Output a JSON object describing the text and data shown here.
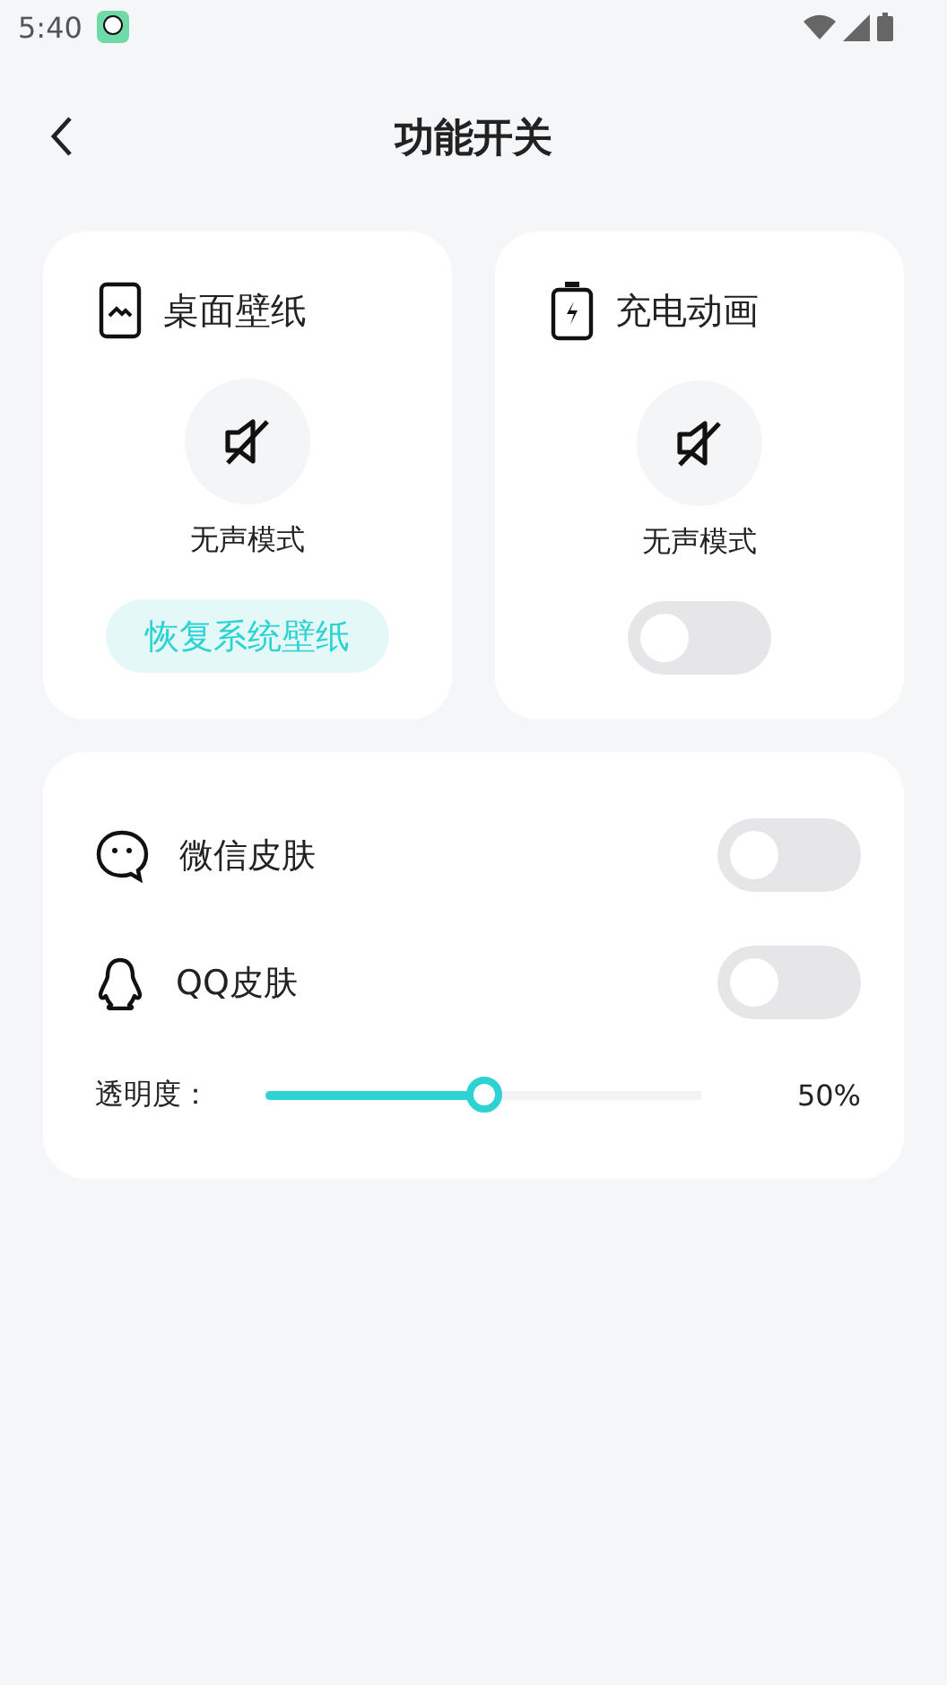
{
  "status_bar": {
    "time": "5:40"
  },
  "header": {
    "title": "功能开关"
  },
  "feature_cards": [
    {
      "kind": "wallpaper",
      "title": "桌面壁纸",
      "mode_label": "无声模式",
      "action": {
        "kind": "button",
        "label": "恢复系统壁纸"
      }
    },
    {
      "kind": "battery",
      "title": "充电动画",
      "mode_label": "无声模式",
      "action": {
        "kind": "toggle",
        "on": false
      }
    }
  ],
  "skins": [
    {
      "kind": "chat",
      "label": "微信皮肤",
      "on": false
    },
    {
      "kind": "penguin",
      "label": "QQ皮肤",
      "on": false
    }
  ],
  "opacity": {
    "label": "透明度：",
    "level": 0.5,
    "reading": "50%"
  }
}
